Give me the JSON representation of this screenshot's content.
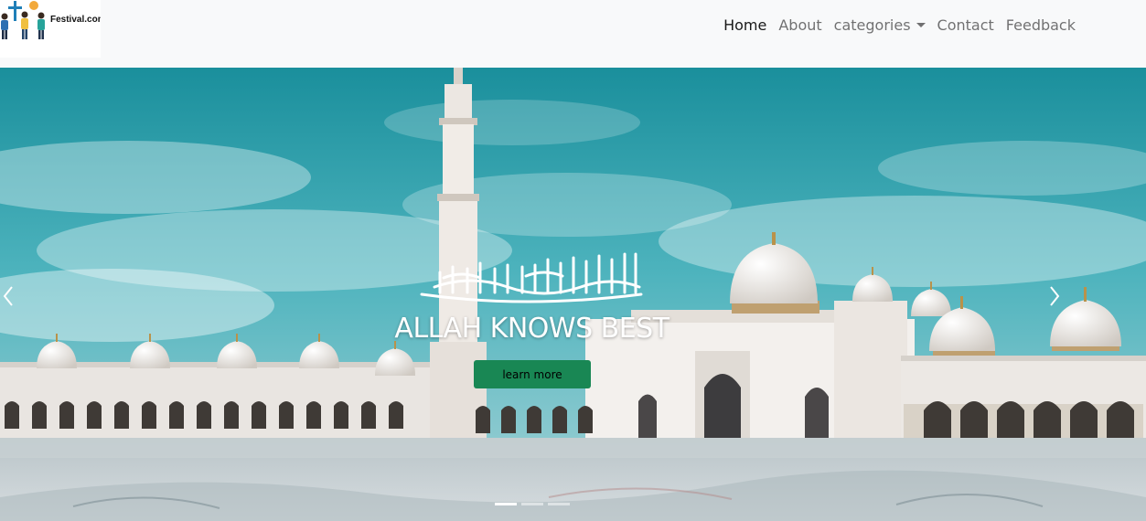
{
  "header": {
    "logo_text": "Festival.com",
    "nav": {
      "home": "Home",
      "about": "About",
      "categories": "categories",
      "contact": "Contact",
      "feedback": "Feedback"
    }
  },
  "carousel": {
    "caption_title": "ALLAH KNOWS BEST",
    "button_label": "learn more",
    "slide_count": 3,
    "active_slide": 1,
    "prev_icon": "chevron-left-icon",
    "next_icon": "chevron-right-icon"
  },
  "colors": {
    "navbar_bg": "#f8f9fa",
    "button_bg": "#198754",
    "sky": "#2aa3ad"
  }
}
